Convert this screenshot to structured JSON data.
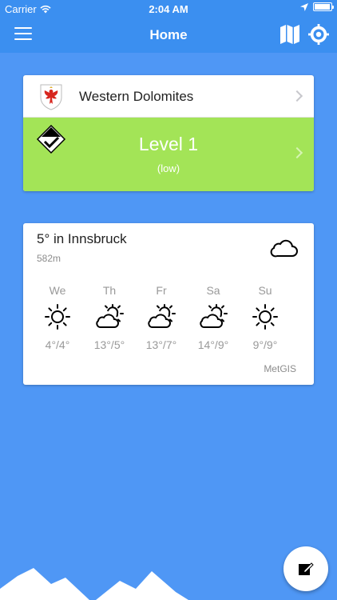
{
  "status_bar": {
    "carrier": "Carrier",
    "time": "2:04 AM"
  },
  "nav": {
    "title": "Home",
    "menu_icon": "hamburger-icon",
    "map_icon": "map-icon",
    "locate_icon": "location-target-icon"
  },
  "region": {
    "name": "Western Dolomites",
    "crest_icon": "eagle-crest-icon"
  },
  "danger": {
    "level": "Level 1",
    "description": "(low)",
    "icon": "danger-level-1-icon",
    "color": "#a3e457"
  },
  "weather": {
    "location": "5° in Innsbruck",
    "altitude": "582m",
    "current_icon": "cloud-icon",
    "provider": "MetGIS",
    "days": [
      {
        "name": "We",
        "icon": "sun",
        "temps": "4°/4°"
      },
      {
        "name": "Th",
        "icon": "partly-cloudy",
        "temps": "13°/5°"
      },
      {
        "name": "Fr",
        "icon": "partly-cloudy",
        "temps": "13°/7°"
      },
      {
        "name": "Sa",
        "icon": "partly-cloudy",
        "temps": "14°/9°"
      },
      {
        "name": "Su",
        "icon": "sun",
        "temps": "9°/9°"
      }
    ]
  },
  "fab": {
    "icon": "edit-note-icon"
  },
  "colors": {
    "primary": "#3b8ff0",
    "background": "#4f97f5",
    "danger_low": "#a3e457"
  }
}
